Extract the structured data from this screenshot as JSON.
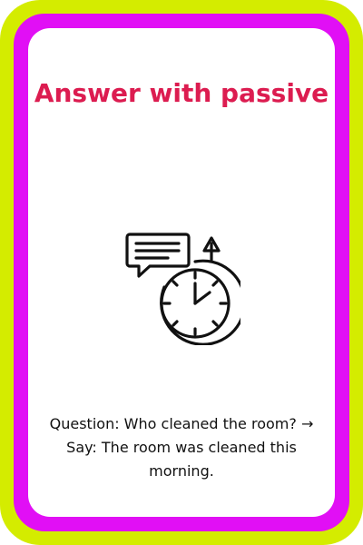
{
  "card": {
    "title": "Answer with passive",
    "body": "Question: Who cleaned the room? → Say: The room was cleaned this morning.",
    "icon": "chat-clock-icon",
    "colors": {
      "outer_border": "#d4ec00",
      "inner_border": "#e10ff5",
      "title": "#dc1c50",
      "text": "#111111",
      "background": "#ffffff"
    }
  }
}
